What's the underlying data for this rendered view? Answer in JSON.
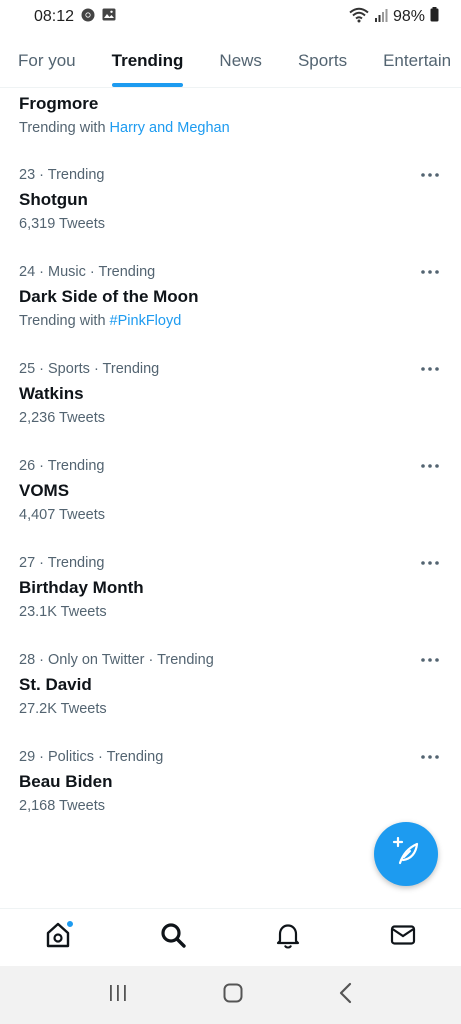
{
  "status_bar": {
    "time": "08:12",
    "battery": "98%"
  },
  "tabs": [
    {
      "label": "For you"
    },
    {
      "label": "Trending"
    },
    {
      "label": "News"
    },
    {
      "label": "Sports"
    },
    {
      "label": "Entertain"
    }
  ],
  "trends": [
    {
      "meta": "",
      "title": "Frogmore",
      "sub_prefix": "Trending with ",
      "sub_link": "Harry and Meghan"
    },
    {
      "meta": "23 · Trending",
      "title": "Shotgun",
      "sub_prefix": "6,319 Tweets",
      "sub_link": ""
    },
    {
      "meta": "24 · Music · Trending",
      "title": "Dark Side of the Moon",
      "sub_prefix": "Trending with ",
      "sub_link": "#PinkFloyd"
    },
    {
      "meta": "25 · Sports · Trending",
      "title": "Watkins",
      "sub_prefix": "2,236 Tweets",
      "sub_link": ""
    },
    {
      "meta": "26 · Trending",
      "title": "VOMS",
      "sub_prefix": "4,407 Tweets",
      "sub_link": ""
    },
    {
      "meta": "27 · Trending",
      "title": "Birthday Month",
      "sub_prefix": "23.1K Tweets",
      "sub_link": ""
    },
    {
      "meta": "28 · Only on Twitter · Trending",
      "title": "St. David",
      "sub_prefix": "27.2K Tweets",
      "sub_link": ""
    },
    {
      "meta": "29 · Politics · Trending",
      "title": "Beau Biden",
      "sub_prefix": "2,168 Tweets",
      "sub_link": ""
    }
  ],
  "colors": {
    "accent": "#1d9bf0",
    "text": "#0f1419",
    "secondary": "#536471"
  },
  "icons": {
    "more": "more-horizontal-icon",
    "fab": "compose-feather-icon",
    "nav": [
      "home-icon",
      "search-icon",
      "bell-icon",
      "mail-icon"
    ],
    "system": [
      "recent-apps-icon",
      "home-button-icon",
      "back-icon"
    ]
  }
}
